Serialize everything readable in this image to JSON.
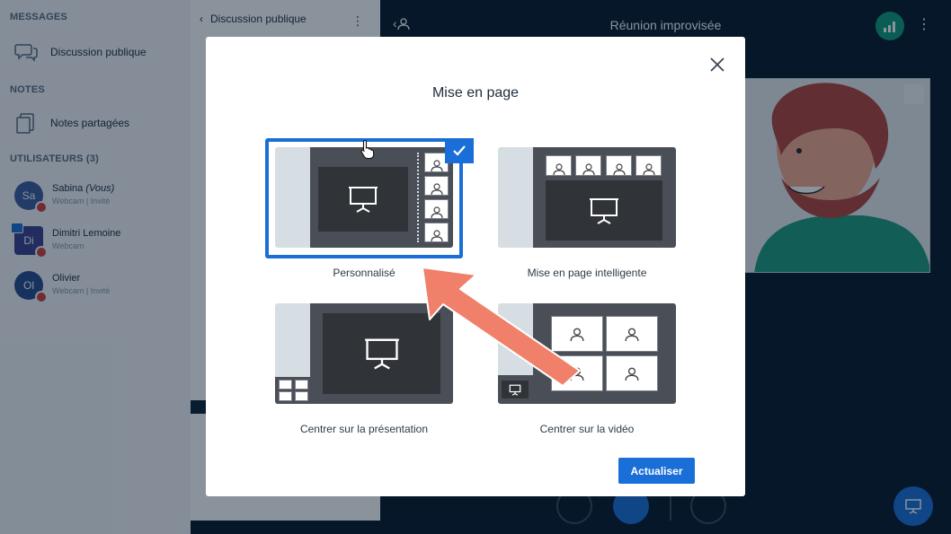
{
  "sidebar": {
    "messages_heading": "MESSAGES",
    "public_chat": "Discussion publique",
    "notes_heading": "NOTES",
    "shared_notes": "Notes partagées",
    "users_heading": "UTILISATEURS (3)",
    "users": [
      {
        "initials": "Sa",
        "name": "Sabina",
        "you": "(Vous)",
        "sub": "Webcam | Invité",
        "color": "#3c5b9e"
      },
      {
        "initials": "Di",
        "name": "Dimitri Lemoine",
        "sub": "Webcam",
        "color": "#3b3f8f"
      },
      {
        "initials": "Ol",
        "name": "Olivier",
        "sub": "Webcam | Invité",
        "color": "#274a8c"
      }
    ]
  },
  "chat": {
    "title": "Discussion publique"
  },
  "main": {
    "title": "Réunion improvisée",
    "accent": "#1a6ed8",
    "connection_color": "#0f9b7a"
  },
  "modal": {
    "title": "Mise en page",
    "options": [
      {
        "label": "Personnalisé",
        "selected": true
      },
      {
        "label": "Mise en page intelligente",
        "selected": false
      },
      {
        "label": "Centrer sur la présentation",
        "selected": false
      },
      {
        "label": "Centrer sur la vidéo",
        "selected": false
      }
    ],
    "update_label": "Actualiser"
  }
}
